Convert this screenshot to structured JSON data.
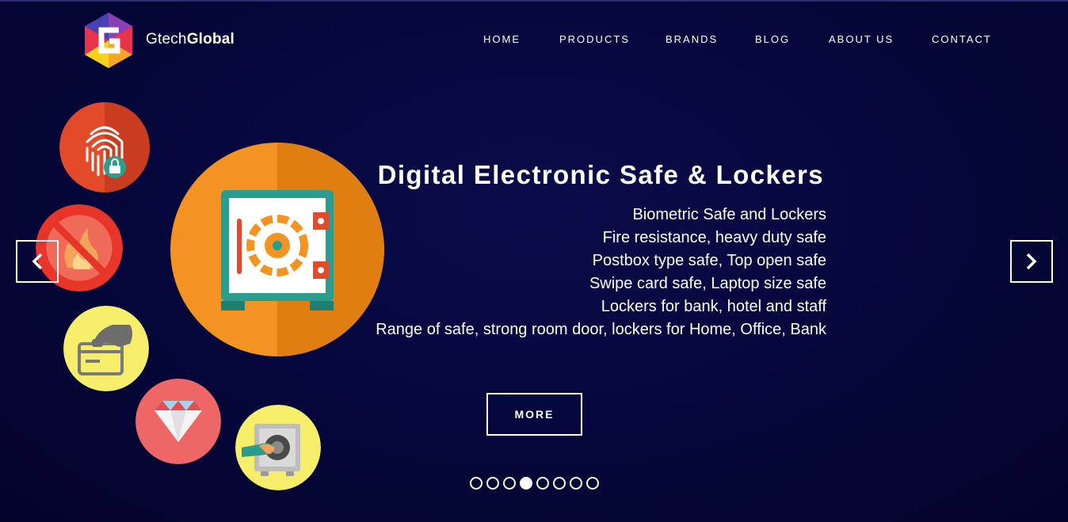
{
  "header": {
    "brand_light": "Gtech",
    "brand_bold": "Global",
    "logo_icon": "gtech-hexagon-logo"
  },
  "nav": {
    "items": [
      {
        "label": "HOME"
      },
      {
        "label": "PRODUCTS"
      },
      {
        "label": "BRANDS"
      },
      {
        "label": "BLOG"
      },
      {
        "label": "ABOUT US"
      },
      {
        "label": "CONTACT"
      }
    ]
  },
  "slider": {
    "headline": "Digital Electronic Safe & Lockers",
    "features": [
      "Biometric Safe and Lockers",
      "Fire resistance, heavy duty safe",
      "Postbox type safe, Top open safe",
      "Swipe card safe, Laptop size safe",
      "Lockers for bank, hotel and staff",
      "Range of safe, strong room door, lockers for Home, Office, Bank"
    ],
    "more_label": "MORE",
    "prev_icon": "chevron-left-icon",
    "next_icon": "chevron-right-icon",
    "slide_count": 8,
    "active_slide": 4
  },
  "icons": [
    "fingerprint-lock-icon",
    "no-fire-icon",
    "swipe-card-icon",
    "diamond-icon",
    "safe-with-hand-icon",
    "safe-icon"
  ],
  "colors": {
    "background": "#05063a",
    "orange": "#f29322",
    "red": "#e24a2a",
    "yellow": "#f6ee6a",
    "coral": "#ee6666",
    "teal": "#2a9d8f"
  }
}
